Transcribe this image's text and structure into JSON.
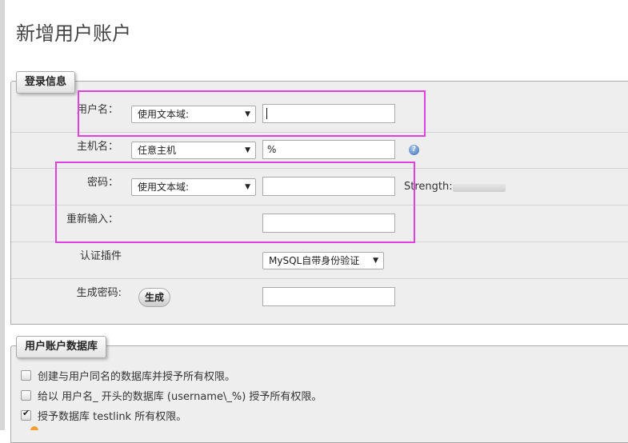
{
  "page": {
    "title": "新增用户账户"
  },
  "login": {
    "legend": "登录信息",
    "username": {
      "label": "用户名：",
      "select_value": "使用文本域:",
      "value": ""
    },
    "host": {
      "label": "主机名：",
      "select_value": "任意主机",
      "value": "%",
      "help_icon": "help-icon"
    },
    "password": {
      "label": "密码：",
      "select_value": "使用文本域:",
      "value": "",
      "strength_label": "Strength:"
    },
    "retype": {
      "label": "重新输入：",
      "value": ""
    },
    "auth_plugin": {
      "label": "认证插件",
      "select_value": "MySQL自带身份验证"
    },
    "generate": {
      "label": "生成密码:",
      "button": "生成",
      "value": ""
    }
  },
  "database": {
    "legend": "用户账户数据库",
    "options": [
      {
        "label": "创建与用户同名的数据库并授予所有权限。",
        "checked": false
      },
      {
        "label": "给以 用户名_ 开头的数据库 (username\\_%) 授予所有权限。",
        "checked": false
      },
      {
        "label": "授予数据库 testlink 所有权限。",
        "checked": true
      }
    ]
  },
  "colors": {
    "highlight": "#e040e0",
    "background": "#eeeeee",
    "border": "#aaaaaa"
  }
}
